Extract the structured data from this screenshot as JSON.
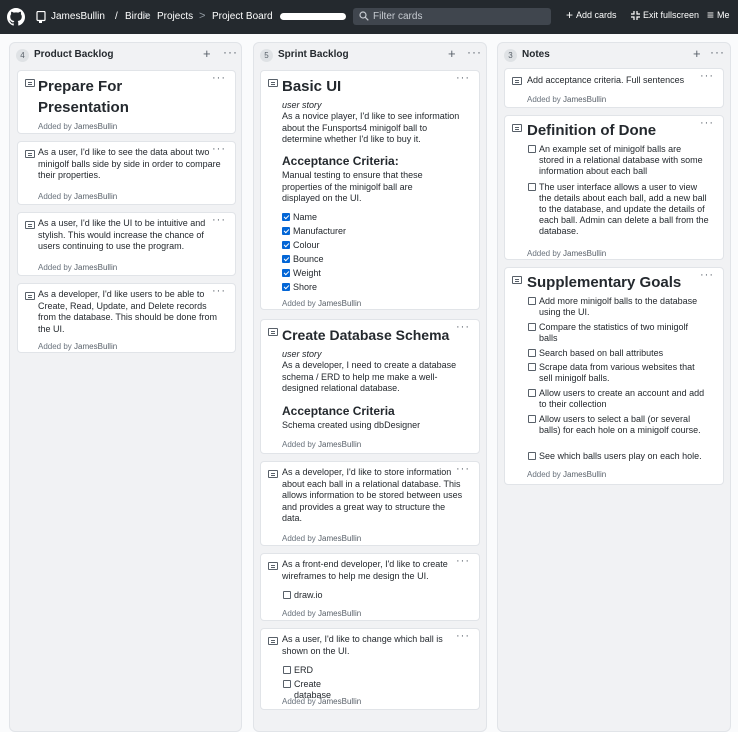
{
  "topbar": {
    "owner": "JamesBullin",
    "slash": "/",
    "repo": "Birdie",
    "crumb_sep": ">",
    "projects": "Projects",
    "board": "Project Board",
    "filter_placeholder": "Filter cards",
    "add_cards": "Add cards",
    "exit_fullscreen": "Exit fullscreen",
    "menu": "Me"
  },
  "columns": [
    {
      "count": "4",
      "title": "Product Backlog",
      "cards": [
        {
          "title": "Prepare For Presentation",
          "added_prefix": "Added by",
          "added_by": "JamesBullin"
        },
        {
          "text": "As a user, I'd like to see the data about two minigolf balls side by side in order to compare their properties.",
          "added_prefix": "Added by",
          "added_by": "JamesBullin"
        },
        {
          "text": "As a user, I'd like the UI to be intuitive and stylish. This would increase the chance of users continuing to use the program.",
          "added_prefix": "Added by",
          "added_by": "JamesBullin"
        },
        {
          "text": "As a developer, I'd like users to be able to Create, Read, Update, and Delete records from the database. This should be done from the UI.",
          "added_prefix": "Added by",
          "added_by": "JamesBullin"
        }
      ]
    },
    {
      "count": "5",
      "title": "Sprint Backlog",
      "cards": [
        {
          "title": "Basic UI",
          "subtitle": "user story",
          "text": "As a novice player, I'd like to see information about the Funsports4 minigolf ball to determine whether I'd like to buy it.",
          "criteria_title": "Acceptance Criteria:",
          "criteria_text": "Manual testing to ensure that these properties of the minigolf ball are displayed on the UI.",
          "checks": [
            "Name",
            "Manufacturer",
            "Colour",
            "Bounce",
            "Weight",
            "Shore"
          ],
          "added_prefix": "Added by",
          "added_by": "JamesBullin"
        },
        {
          "title": "Create Database Schema",
          "subtitle": "user story",
          "text": "As a developer, I need to create a database schema / ERD to help me make a well-designed relational database.",
          "criteria_title": "Acceptance Criteria",
          "criteria_text": "Schema created using dbDesigner",
          "added_prefix": "Added by",
          "added_by": "JamesBullin"
        },
        {
          "text": "As a developer, I'd like to store information about each ball in a relational database. This allows information to be stored between uses and provides a great way to structure the data.",
          "added_prefix": "Added by",
          "added_by": "JamesBullin"
        },
        {
          "text": "As a front-end developer, I'd like to create wireframes to help me design the UI.",
          "checks": [
            "draw.io"
          ],
          "added_prefix": "Added by",
          "added_by": "JamesBullin"
        },
        {
          "text": "As a user, I'd like to change which ball is shown on the UI.",
          "checks": [
            "ERD",
            "Create database"
          ],
          "added_prefix": "Added by",
          "added_by": "JamesBullin"
        }
      ]
    },
    {
      "count": "3",
      "title": "Notes",
      "cards": [
        {
          "text": "Add acceptance criteria. Full sentences",
          "added_prefix": "Added by",
          "added_by": "JamesBullin"
        },
        {
          "title": "Definition of Done",
          "checks": [
            "An example set of minigolf balls are stored in a relational database with some information about each ball",
            "The user interface allows a user to view the details about each ball, add a new ball to the database, and update the details of each ball. Admin can delete a ball from the database."
          ],
          "added_prefix": "Added by",
          "added_by": "JamesBullin"
        },
        {
          "title": "Supplementary Goals",
          "checks": [
            "Add more minigolf balls to the database using the UI.",
            "Compare the statistics of two minigolf balls",
            "Search based on ball attributes",
            "Scrape data from various websites that sell minigolf balls.",
            "Allow users to create an account and add to their collection",
            "Allow users to select a ball (or several balls) for each hole on a minigolf course.",
            "See which balls users play on each hole."
          ],
          "added_prefix": "Added by",
          "added_by": "JamesBullin"
        }
      ]
    }
  ]
}
